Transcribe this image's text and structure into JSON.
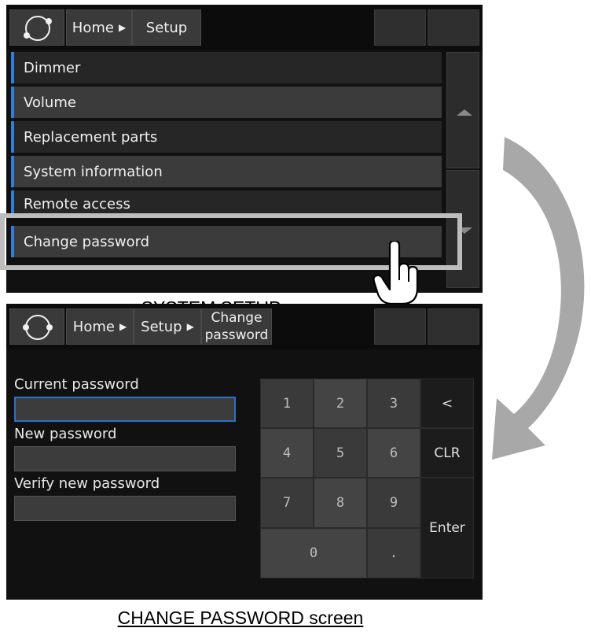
{
  "screen1": {
    "breadcrumbs": [
      {
        "label": "Home",
        "arrow": "▶"
      },
      {
        "label": "Setup"
      }
    ],
    "menu": [
      {
        "label": "Dimmer"
      },
      {
        "label": "Volume"
      },
      {
        "label": "Replacement parts"
      },
      {
        "label": "System information"
      },
      {
        "label": "Remote access"
      },
      {
        "label": "Change password"
      }
    ],
    "caption": "SYSTEM SETUP screen"
  },
  "screen2": {
    "breadcrumbs": [
      {
        "label": "Home",
        "arrow": "▶"
      },
      {
        "label": "Setup",
        "arrow": "▶"
      },
      {
        "line1": "Change",
        "line2": "password"
      }
    ],
    "fields": [
      {
        "label": "Current password",
        "value": ""
      },
      {
        "label": "New password",
        "value": ""
      },
      {
        "label": "Verify new password",
        "value": ""
      }
    ],
    "keys": {
      "k1": "1",
      "k2": "2",
      "k3": "3",
      "back": "<",
      "k4": "4",
      "k5": "5",
      "k6": "6",
      "clr": "CLR",
      "k7": "7",
      "k8": "8",
      "k9": "9",
      "enter": "Enter",
      "k0": "0",
      "dot": "."
    },
    "caption": "CHANGE PASSWORD screen"
  },
  "icons": {
    "logo": "refresh-circle-icon",
    "pointer": "hand-pointer-icon",
    "transition": "curved-arrow-icon",
    "scroll_up": "triangle-up-icon",
    "scroll_down": "triangle-down-icon"
  },
  "colors": {
    "accent": "#2f7fd8",
    "highlight": "#bdbdbd",
    "arrow": "#a8a8a8"
  }
}
